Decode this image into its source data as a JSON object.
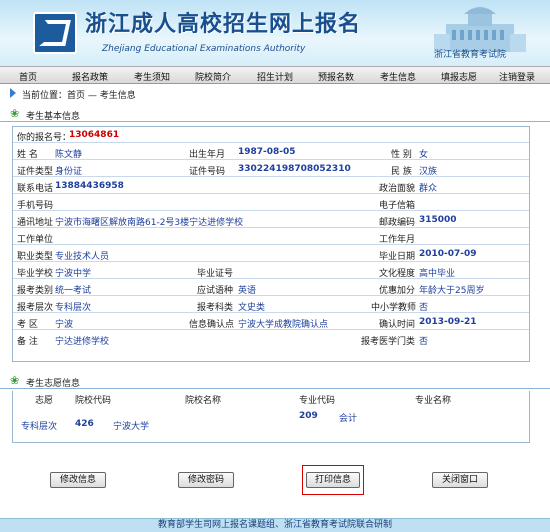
{
  "header": {
    "title": "浙江成人高校招生网上报名",
    "subtitle": "Zhejiang Educational Examinations Authority",
    "department": "浙江省教育考试院"
  },
  "nav": {
    "items": [
      "首页",
      "报名政策",
      "考生须知",
      "院校简介",
      "招生计划",
      "预报名数",
      "考生信息",
      "填报志愿",
      "注销登录"
    ]
  },
  "breadcrumb": "当前位置：首页 — 考生信息",
  "basic_section": {
    "title": "考生基本信息"
  },
  "registration": {
    "label": "你的报名号：",
    "value": "13064861"
  },
  "fields": {
    "name": {
      "label": "姓    名",
      "value": "陈文静"
    },
    "birth": {
      "label": "出生年月",
      "value": "1987-08-05"
    },
    "gender": {
      "label": "性 别",
      "value": "女"
    },
    "id_type": {
      "label": "证件类型",
      "value": "身份证"
    },
    "id_no": {
      "label": "证件号码",
      "value": "330224198708052310"
    },
    "ethnicity": {
      "label": "民 族",
      "value": "汉族"
    },
    "phone": {
      "label": "联系电话",
      "value": "13884436958"
    },
    "politics": {
      "label": "政治面貌",
      "value": "群众"
    },
    "mobile": {
      "label": "手机号码",
      "value": ""
    },
    "email": {
      "label": "电子信箱",
      "value": ""
    },
    "address": {
      "label": "通讯地址",
      "value": "宁波市海曙区解放南路61-2号3楼宁达进修学校"
    },
    "postcode": {
      "label": "邮政编码",
      "value": "315000"
    },
    "work_unit": {
      "label": "工作单位",
      "value": ""
    },
    "work_years": {
      "label": "工作年月",
      "value": ""
    },
    "occupation": {
      "label": "职业类型",
      "value": "专业技术人员"
    },
    "grad_date": {
      "label": "毕业日期",
      "value": "2010-07-09"
    },
    "grad_school": {
      "label": "毕业学校",
      "value": "宁波中学"
    },
    "diploma_no": {
      "label": "毕业证号",
      "value": ""
    },
    "education": {
      "label": "文化程度",
      "value": "高中毕业"
    },
    "exam_category": {
      "label": "报考类别",
      "value": "统一考试"
    },
    "exam_lang": {
      "label": "应试语种",
      "value": "英语"
    },
    "bonus": {
      "label": "优惠加分",
      "value": "年龄大于25周岁"
    },
    "exam_level": {
      "label": "报考层次",
      "value": "专科层次"
    },
    "exam_subject": {
      "label": "报考科类",
      "value": "文史类"
    },
    "teacher": {
      "label": "中小学教师",
      "value": "否"
    },
    "district": {
      "label": "考 区",
      "value": "宁波"
    },
    "confirm_point": {
      "label": "信息确认点",
      "value": "宁波大学成教院确认点"
    },
    "confirm_time": {
      "label": "确认时间",
      "value": "2013-09-21"
    },
    "remark": {
      "label": "备 注",
      "value": "宁达进修学校"
    },
    "medical": {
      "label": "报考医学门类",
      "value": "否"
    }
  },
  "wish_section": {
    "title": "考生志愿信息",
    "headers": [
      "志愿",
      "院校代码",
      "院校名称",
      "专业代码",
      "专业名称"
    ],
    "row": {
      "wish": "专科层次",
      "school_code": "426",
      "school_name": "宁波大学",
      "major_code": "209",
      "major_name": "会计"
    }
  },
  "buttons": {
    "edit_info": "修改信息",
    "edit_password": "修改密码",
    "print_info": "打印信息",
    "close_window": "关闭窗口"
  },
  "footer": "教育部学生司网上报名课题组、浙江省教育考试院联合研制"
}
